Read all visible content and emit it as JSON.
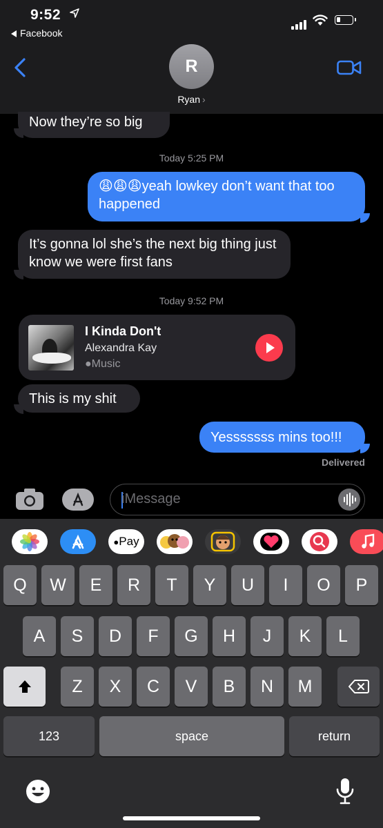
{
  "status": {
    "time": "9:52",
    "back_app": "Facebook"
  },
  "contact": {
    "initial": "R",
    "name": "Ryan"
  },
  "messages": {
    "m1": "Now they’re so big",
    "stamp1": "Today 5:25 PM",
    "m2_emoji": "😩😩😩",
    "m2": "yeah lowkey don’t want that too happened",
    "m3": "It’s gonna lol she’s the next big thing just know we were first fans",
    "stamp2": "Today 9:52 PM",
    "music": {
      "title": "I Kinda Don't",
      "artist": "Alexandra Kay",
      "service": "Music"
    },
    "m4": "This is my shit",
    "m5": "Yesssssss mins too!!!",
    "delivered": "Delivered"
  },
  "input": {
    "placeholder": "iMessage"
  },
  "app_strip": [
    {
      "name": "Photos"
    },
    {
      "name": "App Store"
    },
    {
      "name": "Apple Pay",
      "label": "Pay"
    },
    {
      "name": "Animoji"
    },
    {
      "name": "Memoji"
    },
    {
      "name": "Digital Touch"
    },
    {
      "name": "Search"
    },
    {
      "name": "Music"
    }
  ],
  "keyboard": {
    "row1": [
      "Q",
      "W",
      "E",
      "R",
      "T",
      "Y",
      "U",
      "I",
      "O",
      "P"
    ],
    "row2": [
      "A",
      "S",
      "D",
      "F",
      "G",
      "H",
      "J",
      "K",
      "L"
    ],
    "row3": [
      "Z",
      "X",
      "C",
      "V",
      "B",
      "N",
      "M"
    ],
    "numbers": "123",
    "space": "space",
    "return": "return"
  },
  "colors": {
    "outgoing": "#3b82f6",
    "incoming": "#26252a",
    "accent": "#3b82f6"
  }
}
